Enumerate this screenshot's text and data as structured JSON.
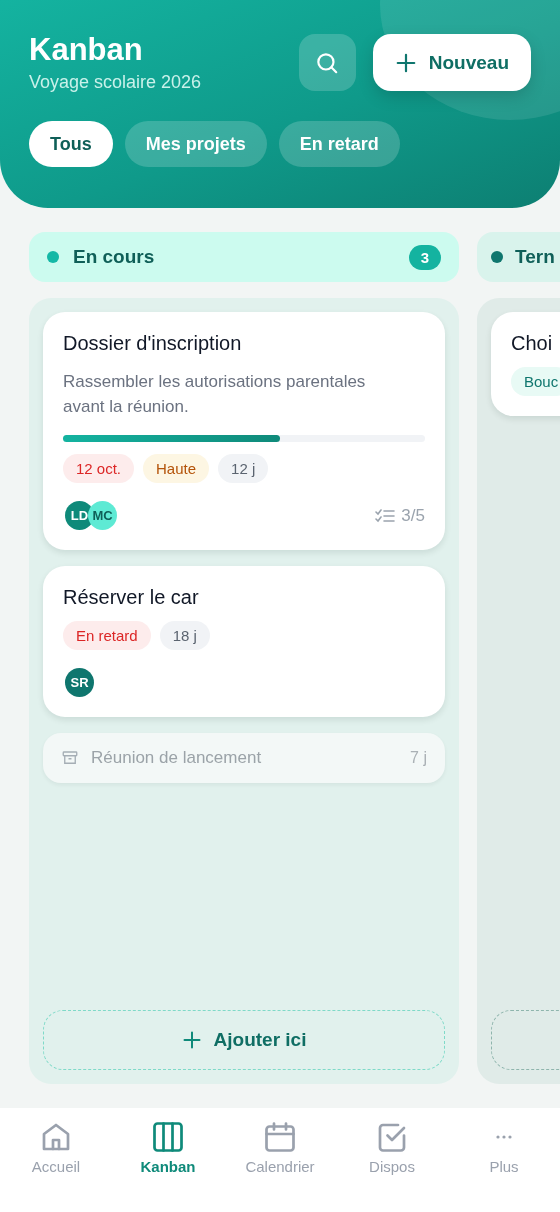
{
  "header": {
    "title": "Kanban",
    "subtitle": "Voyage scolaire 2026",
    "new_button": "Nouveau"
  },
  "filters": [
    {
      "label": "Tous",
      "selected": true
    },
    {
      "label": "Mes projets",
      "selected": false
    },
    {
      "label": "En retard",
      "selected": false
    }
  ],
  "columns": [
    {
      "title": "En cours",
      "color": "#14b8a6",
      "count": "3",
      "cards": [
        {
          "title": "Dossier d'inscription",
          "description": "Rassembler les autorisations parentales avant la réunion.",
          "level": 0.6,
          "tags": [
            {
              "text": "12 oct.",
              "kind": "danger"
            },
            {
              "text": "Haute",
              "kind": "warning"
            },
            {
              "text": "12 j",
              "kind": "neutral"
            }
          ],
          "avatars": [
            {
              "initials": "LD",
              "color": "#0f8a7a"
            },
            {
              "initials": "MC",
              "color": "#5eead4"
            }
          ],
          "checklist": "3/5"
        },
        {
          "title": "Réserver le car",
          "tags": [
            {
              "text": "En retard",
              "kind": "danger"
            },
            {
              "text": "18 j",
              "kind": "neutral"
            }
          ],
          "avatars": [
            {
              "initials": "SR",
              "color": "#0f766e"
            }
          ]
        }
      ],
      "archived": [
        {
          "title": "Réunion de lancement",
          "days": "7 j"
        }
      ],
      "add_label": "Ajouter ici"
    },
    {
      "title": "Tern",
      "color": "#0f766e",
      "cards": [
        {
          "title": "Choi",
          "tags": [
            {
              "text": "Bouc",
              "kind": "accent"
            }
          ]
        }
      ]
    }
  ],
  "nav": [
    {
      "label": "Accueil",
      "selected": false
    },
    {
      "label": "Kanban",
      "selected": true
    },
    {
      "label": "Calendrier",
      "selected": false
    },
    {
      "label": "Dispos",
      "selected": false
    },
    {
      "label": "Plus",
      "selected": false
    }
  ]
}
